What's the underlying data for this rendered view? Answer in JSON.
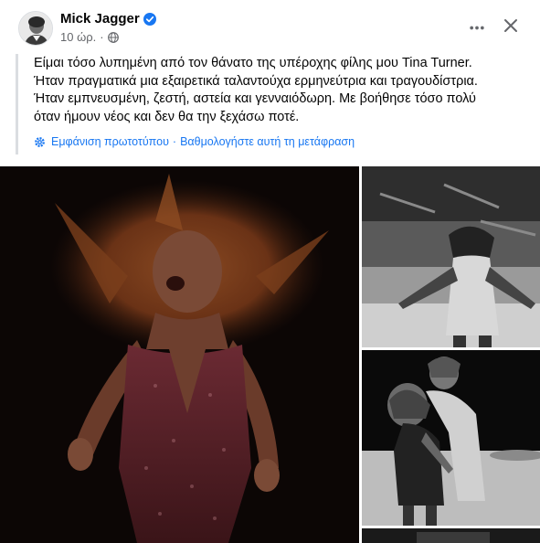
{
  "post": {
    "author": "Mick Jagger",
    "time": "10 ώρ.",
    "separator": "·",
    "text": "Είμαι τόσο λυπημένη από τον θάνατο της υπέροχης φίλης μου Tina Turner.\nΉταν πραγματικά μια εξαιρετικά ταλαντούχα ερμηνεύτρια και τραγουδίστρια.\nΉταν εμπνευσμένη, ζεστή, αστεία και γενναιόδωρη. Με βοήθησε τόσο πολύ\nόταν ήμουν νέος και δεν θα την ξεχάσω ποτέ.",
    "show_original": "Εμφάνιση πρωτοτύπου",
    "rate_translation": "Βαθμολογήστε αυτή τη μετάφραση",
    "translate_separator": "·"
  },
  "icons": {
    "verified": "verified-badge-icon",
    "privacy": "globe-icon",
    "more": "more-horizontal-icon",
    "close": "close-icon",
    "translate": "gear-icon"
  },
  "colors": {
    "link": "#1877f2",
    "secondary_text": "#65676b",
    "quote_bar": "#dadde1"
  },
  "photos": [
    {
      "name": "photo-1",
      "description": "color"
    },
    {
      "name": "photo-2",
      "description": "bw"
    },
    {
      "name": "photo-3",
      "description": "bw"
    },
    {
      "name": "photo-4",
      "description": "bw"
    }
  ]
}
